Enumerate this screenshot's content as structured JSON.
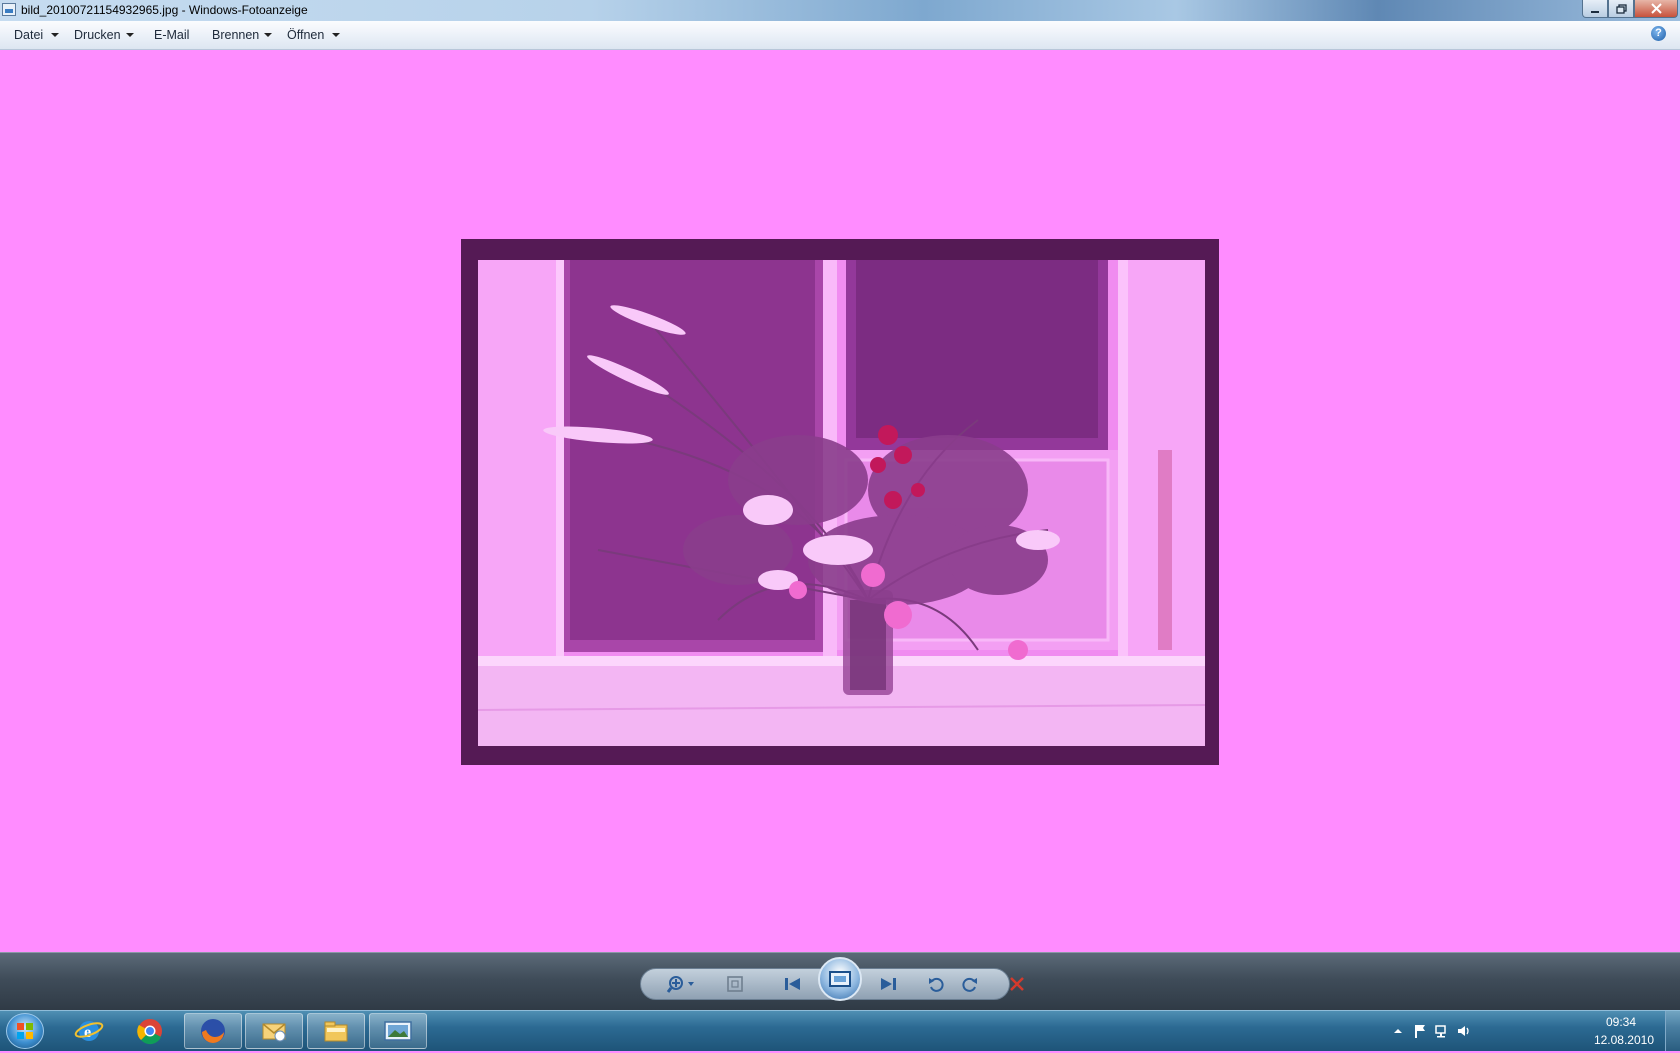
{
  "window": {
    "title": "bild_20100721154932965.jpg - Windows-Fotoanzeige",
    "minimize_icon": "minimize-icon",
    "maximize_icon": "restore-icon",
    "close_icon": "close-icon"
  },
  "menu": {
    "items": [
      {
        "label": "Datei",
        "has_dropdown": true
      },
      {
        "label": "Drucken",
        "has_dropdown": true
      },
      {
        "label": "E-Mail",
        "has_dropdown": false
      },
      {
        "label": "Brennen",
        "has_dropdown": true
      },
      {
        "label": "Öffnen",
        "has_dropdown": true
      }
    ],
    "help_icon": "help-icon",
    "help_glyph": "?"
  },
  "viewer": {
    "background_color": "#ff8cff",
    "photo_frame_color": "#551a55",
    "photo_subject": "flower bouquet in glass vase on window sill, magenta-tinted"
  },
  "controls": {
    "buttons": [
      "zoom-icon",
      "actual-size-icon",
      "previous-icon",
      "slideshow-icon",
      "next-icon",
      "rotate-left-icon",
      "rotate-right-icon",
      "delete-icon"
    ]
  },
  "taskbar": {
    "apps": [
      "internet-explorer-icon",
      "chrome-icon",
      "firefox-icon",
      "outlook-icon",
      "explorer-folder-icon",
      "photo-viewer-icon"
    ],
    "active_app": "photo-viewer-icon",
    "clock": {
      "time": "09:34",
      "date": "12.08.2010"
    }
  }
}
